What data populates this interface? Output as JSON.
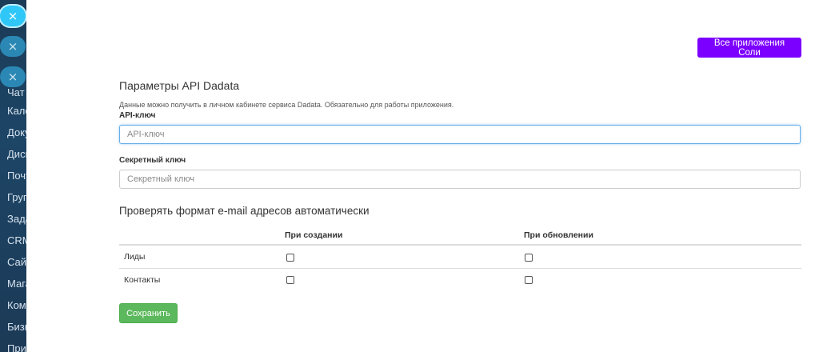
{
  "sidebar": {
    "close_glyph": "×",
    "items": [
      {
        "label": "Чат"
      },
      {
        "label": "Кале"
      },
      {
        "label": "Доку"
      },
      {
        "label": "Диск"
      },
      {
        "label": "Почт"
      },
      {
        "label": "Груп"
      },
      {
        "label": "Зада"
      },
      {
        "label": "CRM"
      },
      {
        "label": "Сайт"
      },
      {
        "label": "Мага"
      },
      {
        "label": "Комп"
      },
      {
        "label": "Бизн"
      },
      {
        "label": "Прил"
      }
    ]
  },
  "header": {
    "apps_button_label": "Все приложения Соли",
    "apps_button_color": "#7b00ff"
  },
  "settings": {
    "title": "Параметры API Dadata",
    "hint": "Данные можно получить в личном кабинете сервиса Dadata. Обязательно для работы приложения.",
    "api_key": {
      "label": "API-ключ",
      "placeholder": "API-ключ",
      "value": ""
    },
    "secret_key": {
      "label": "Секретный ключ",
      "placeholder": "Секретный ключ",
      "value": ""
    }
  },
  "email_check": {
    "title": "Проверять формат e-mail адресов автоматически",
    "columns": [
      "",
      "При создании",
      "При обновлении"
    ],
    "rows": [
      {
        "label": "Лиды",
        "on_create": false,
        "on_update": false
      },
      {
        "label": "Контакты",
        "on_create": false,
        "on_update": false
      }
    ]
  },
  "actions": {
    "save_label": "Сохранить",
    "save_color": "#5cb85c"
  }
}
